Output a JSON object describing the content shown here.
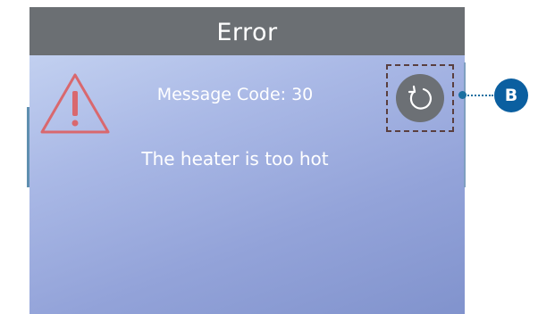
{
  "screen": {
    "title": "Error",
    "message_code_label": "Message Code: 30",
    "message_text": "The heater is too hot"
  },
  "icons": {
    "warning": "warning-triangle-icon",
    "refresh": "refresh-icon"
  },
  "callout": {
    "label": "B"
  },
  "colors": {
    "title_bar": "#6b6f73",
    "warning": "#d9686e",
    "callout": "#0b5fa0",
    "text": "#ffffff"
  }
}
